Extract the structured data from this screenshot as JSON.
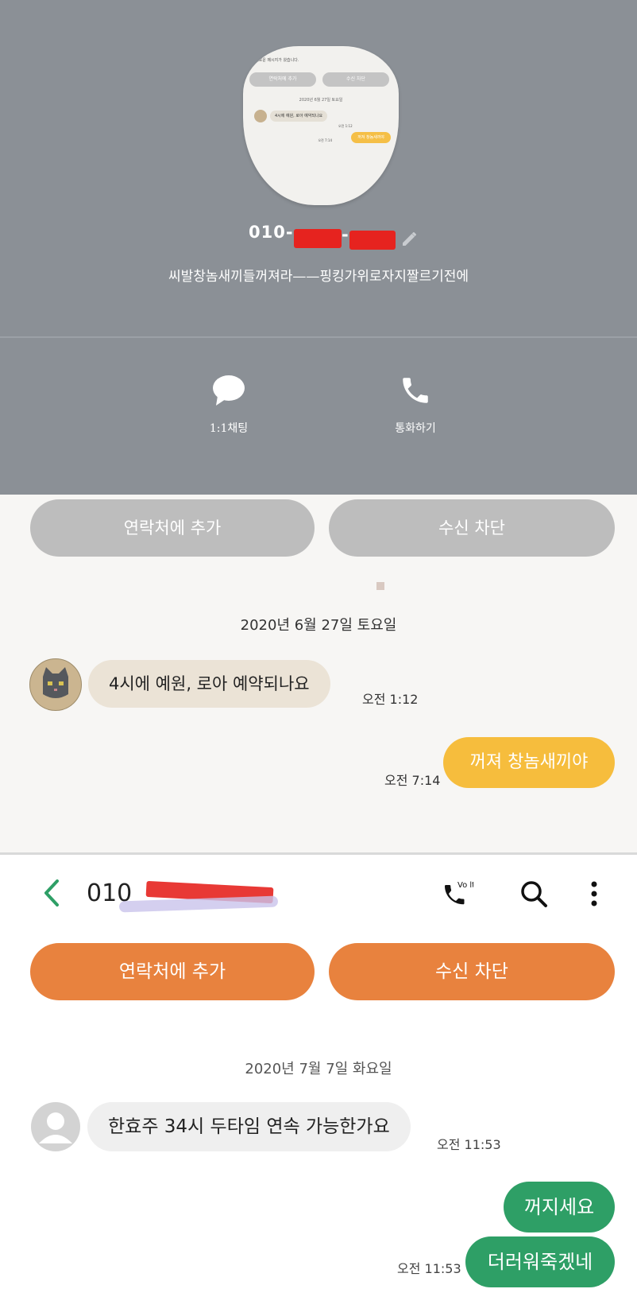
{
  "profile": {
    "phone_prefix": "010-",
    "phone_separator": "-",
    "status_message": "씨발창놈새끼들꺼져라——핑킹가위로자지짤르기전에",
    "chat_label": "1:1채팅",
    "call_label": "통화하기",
    "thumbnail": {
      "header_text": "\"♪ 새로운 메시지가 왔습니다.",
      "add_contact": "연락처에 추가",
      "block": "수신 차단",
      "date": "2020년 6월 27일 토요일",
      "incoming": "4시에 예원, 로아 예약되나요",
      "incoming_time": "오전 1:12",
      "outgoing": "꺼져 창놈새끼야",
      "outgoing_time": "오전 7:14"
    }
  },
  "chat1": {
    "add_contact": "연락처에 추가",
    "block": "수신 차단",
    "date": "2020년 6월 27일 토요일",
    "incoming": "4시에 예원, 로아 예약되나요",
    "incoming_time": "오전 1:12",
    "outgoing": "꺼져 창놈새끼야",
    "outgoing_time": "오전 7:14"
  },
  "chat2": {
    "contact_name": "010",
    "call_badge": "Vo lte",
    "add_contact": "연락처에 추가",
    "block": "수신 차단",
    "date": "2020년 7월 7일 화요일",
    "incoming": "한효주 34시 두타임 연속 가능한가요",
    "incoming_time": "오전 11:53",
    "outgoing": [
      "꺼지세요",
      "더러워죽겠네"
    ],
    "outgoing_time": "오전 11:53"
  },
  "colors": {
    "profile_bg": "#8b9096",
    "gray_button": "#bdbdbd",
    "yellow_bubble": "#f6bd3d",
    "orange_button": "#e8823e",
    "green_bubble": "#2e9f66",
    "redaction": "#e6231f"
  }
}
